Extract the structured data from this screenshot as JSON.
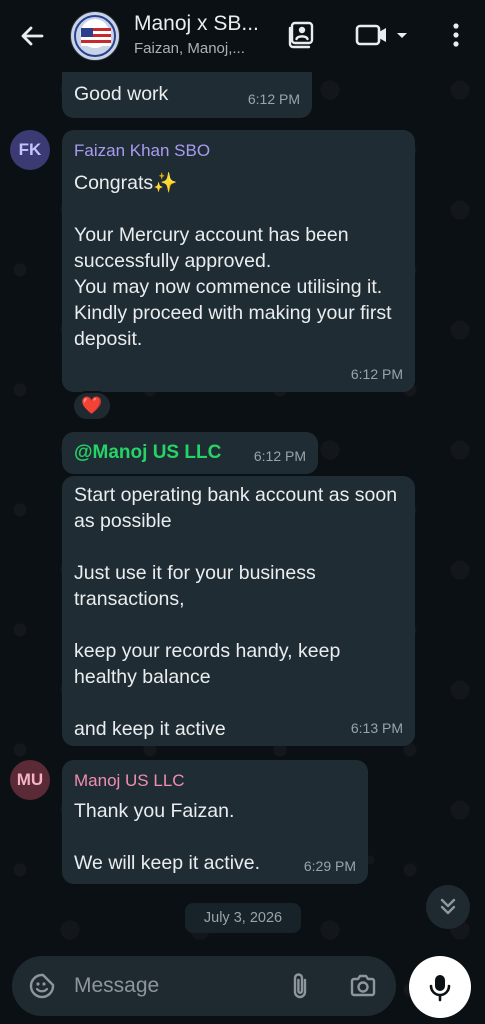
{
  "header": {
    "title": "Manoj x SB...",
    "subtitle": "Faizan, Manoj,...",
    "back_icon": "arrow-left-icon",
    "video_icon": "video-camera-icon"
  },
  "messages": [
    {
      "text": "Good work",
      "time": "6:12 PM"
    },
    {
      "avatar_initials": "FK",
      "avatar_color": "#3b3a73",
      "sender": "Faizan Khan SBO",
      "sender_color": "#a99bf2",
      "text": "Congrats✨\n\nYour Mercury account has been successfully approved.\nYou may now commence utilising it.\nKindly proceed with making your first deposit.",
      "time": "6:12 PM",
      "reaction": "❤️"
    },
    {
      "mention": "@Manoj US LLC",
      "mention_color": "#25d366",
      "time": "6:12 PM"
    },
    {
      "text": "Start operating bank account as soon as possible\n\nJust use it for your business transactions,\n\nkeep your records handy, keep healthy balance\n\nand keep it active",
      "time": "6:13 PM"
    },
    {
      "avatar_initials": "MU",
      "avatar_color": "#5a2a36",
      "sender": "Manoj US LLC",
      "sender_color": "#f08eb0",
      "text": "Thank you Faizan.\n\nWe will keep it active.",
      "time": "6:29 PM"
    }
  ],
  "date_separator": "July 3, 2026",
  "composer": {
    "placeholder": "Message"
  }
}
